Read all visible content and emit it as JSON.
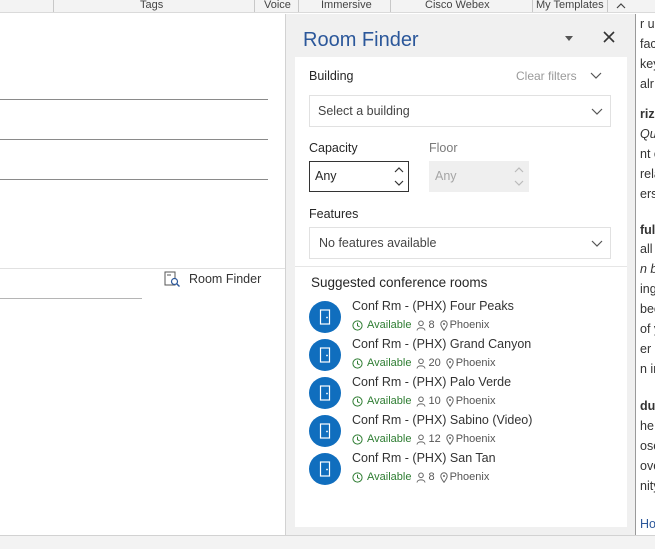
{
  "ribbon": {
    "groups": [
      "Tags",
      "Voice",
      "Immersive",
      "Cisco Webex",
      "My Templates"
    ],
    "collapse_icon": "chevron-up-icon"
  },
  "compose": {
    "room_finder_link": {
      "label": "Room Finder",
      "icon": "room-finder-icon"
    }
  },
  "room_finder": {
    "title": "Room Finder",
    "building": {
      "label": "Building",
      "clear_filters": "Clear filters",
      "placeholder": "Select a building"
    },
    "capacity": {
      "label": "Capacity",
      "value": "Any"
    },
    "floor": {
      "label": "Floor",
      "value": "Any"
    },
    "features": {
      "label": "Features",
      "value": "No features available"
    },
    "suggested_title": "Suggested conference rooms",
    "rooms": [
      {
        "name": "Conf Rm - (PHX) Four Peaks",
        "status": "Available",
        "capacity": "8",
        "location": "Phoenix"
      },
      {
        "name": "Conf Rm - (PHX) Grand Canyon",
        "status": "Available",
        "capacity": "20",
        "location": "Phoenix"
      },
      {
        "name": "Conf Rm - (PHX) Palo Verde",
        "status": "Available",
        "capacity": "10",
        "location": "Phoenix"
      },
      {
        "name": "Conf Rm - (PHX) Sabino (Video)",
        "status": "Available",
        "capacity": "12",
        "location": "Phoenix"
      },
      {
        "name": "Conf Rm - (PHX) San Tan",
        "status": "Available",
        "capacity": "8",
        "location": "Phoenix"
      }
    ]
  },
  "reading_pane": {
    "lines": [
      "r us",
      "fac",
      "key",
      "alr",
      "rize",
      "Qu",
      "nt o",
      "rela",
      "ers",
      "ful",
      "all t",
      "n bo",
      "ing",
      "bee",
      "of y",
      "er p",
      "n in",
      "duc",
      "he p",
      "ose",
      "ove",
      "nity",
      "Ho"
    ]
  },
  "colors": {
    "accent": "#2b579a",
    "room_icon": "#106ebe",
    "available": "#2e7d32"
  }
}
